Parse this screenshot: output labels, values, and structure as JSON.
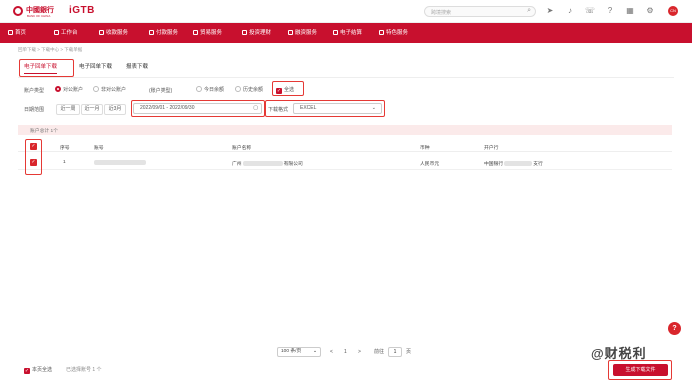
{
  "header": {
    "bank_name": "中國銀行",
    "bank_subtitle": "BANK OF CHINA",
    "brand": "iGTB",
    "search_placeholder": "跨境搜索",
    "avatar_text": "CN"
  },
  "nav": {
    "items": [
      {
        "label": "首页"
      },
      {
        "label": "工作台"
      },
      {
        "label": "收款服务"
      },
      {
        "label": "付款服务"
      },
      {
        "label": "贸易服务"
      },
      {
        "label": "投资理财"
      },
      {
        "label": "融资服务"
      },
      {
        "label": "电子结算"
      },
      {
        "label": "特色服务"
      }
    ]
  },
  "breadcrumb": "回单下载 > 下载中心 > 下载单据",
  "tabs": [
    {
      "label": "电子回单下载"
    },
    {
      "label": "电子回单下载"
    },
    {
      "label": "报表下载"
    }
  ],
  "filters": {
    "account_type_label": "账户类型",
    "account_options": [
      "对公账户",
      "非对公账户"
    ],
    "account_type2_label": "(账户类型)",
    "balance_options": [
      "今日余额",
      "历史余额"
    ],
    "checkbox_all": "全选",
    "date_label": "日期范围",
    "quick_buttons": [
      "近一周",
      "近一月",
      "近3月"
    ],
    "date_range": "2022/09/01 - 2022/09/30",
    "format_label": "下载格式",
    "format_value": "EXCEL"
  },
  "selection": {
    "text": "账户总计 1个"
  },
  "table": {
    "headers": [
      "序号",
      "账号",
      "账户名称",
      "币种",
      "开户行"
    ],
    "rows": [
      {
        "index": "1",
        "account_name_prefix": "广州",
        "account_name_suffix": "有限公司",
        "currency": "人民币元",
        "bank_prefix": "中国银行",
        "bank_suffix": "支行"
      }
    ]
  },
  "pager": {
    "page_size": "100 条/页",
    "prev": "<",
    "current": "1",
    "next": ">",
    "goto_label": "前往",
    "goto_value": "1",
    "page_suffix": "页"
  },
  "footer": {
    "select_page": "本页全选",
    "selected_count": "已选择账号 1 个"
  },
  "watermark": "@财税利",
  "generate_button": "生成下载文件",
  "help": "?"
}
